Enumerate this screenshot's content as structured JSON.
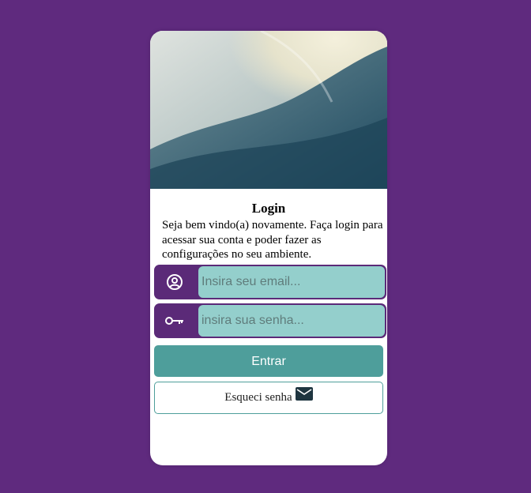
{
  "login": {
    "title": "Login",
    "subtitle": "Seja bem vindo(a) novamente. Faça login para acessar sua conta e poder fazer as configurações no seu ambiente.",
    "email": {
      "placeholder": "Insira seu email...",
      "value": "",
      "icon": "user-circle-icon"
    },
    "password": {
      "placeholder": "insira sua senha...",
      "value": "",
      "icon": "key-icon"
    },
    "submit_label": "Entrar",
    "forgot_label": "Esqueci senha",
    "forgot_icon": "mail-icon"
  },
  "colors": {
    "background": "#5f2a7e",
    "field_frame": "#5b2a78",
    "input_fill": "#94cfcc",
    "accent": "#4e9e9b",
    "card": "#ffffff"
  }
}
